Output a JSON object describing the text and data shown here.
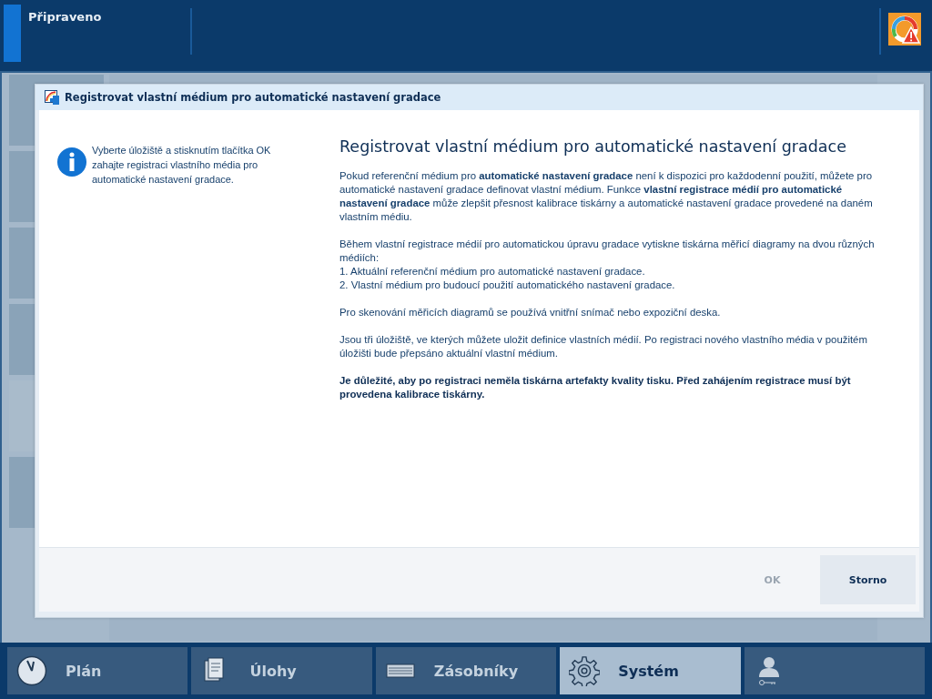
{
  "status_bar": {
    "status": "Připraveno",
    "alert": true
  },
  "dialog": {
    "title": "Registrovat vlastní médium pro automatické nastavení gradace",
    "hint": "Vyberte úložiště a stisknutím tlačítka OK zahajte registraci vlastního média pro automatické nastavení gradace.",
    "heading": "Registrovat vlastní médium pro automatické nastavení gradace",
    "paragraphs": [
      {
        "kind": "text",
        "text": "Pokud referenční médium pro **automatické nastavení gradace** není k dispozici pro každodenní použití, můžete pro automatické nastavení gradace definovat vlastní médium. Funkce **vlastní registrace médií pro automatické nastavení gradace** může zlepšit přesnost kalibrace tiskárny a automatické nastavení gradace provedené na daném vlastním médiu."
      },
      {
        "kind": "line",
        "text": "Během vlastní registrace médií pro automatickou úpravu gradace vytiskne tiskárna měřicí diagramy na dvou různých médiích:"
      },
      {
        "kind": "line",
        "text": "1. Aktuální referenční médium pro automatické nastavení gradace."
      },
      {
        "kind": "text",
        "text": "2. Vlastní médium pro budoucí použití automatického nastavení gradace."
      },
      {
        "kind": "text",
        "text": "Pro skenování měřicích diagramů se používá vnitřní snímač nebo expoziční deska."
      },
      {
        "kind": "text",
        "text": "Jsou tři úložiště, ve kterých můžete uložit definice vlastních médií. Po registraci nového vlastního média v použitém úložišti bude přepsáno aktuální vlastní médium."
      },
      {
        "kind": "warning",
        "text": "Je důležité, aby po registraci neměla tiskárna artefakty kvality tisku. Před zahájením registrace musí být provedena kalibrace tiskárny."
      }
    ],
    "buttons": [
      {
        "label": "OK",
        "disabled": true
      },
      {
        "label": "Storno",
        "disabled": false
      }
    ]
  },
  "nav": [
    {
      "kind": "clock",
      "label": "Plán",
      "selected": false
    },
    {
      "kind": "document",
      "label": "Úlohy",
      "selected": false
    },
    {
      "kind": "tray",
      "label": "Zásobníky",
      "selected": false
    },
    {
      "kind": "gear",
      "label": "Systém",
      "selected": true
    },
    {
      "kind": "user",
      "selected": false
    }
  ]
}
